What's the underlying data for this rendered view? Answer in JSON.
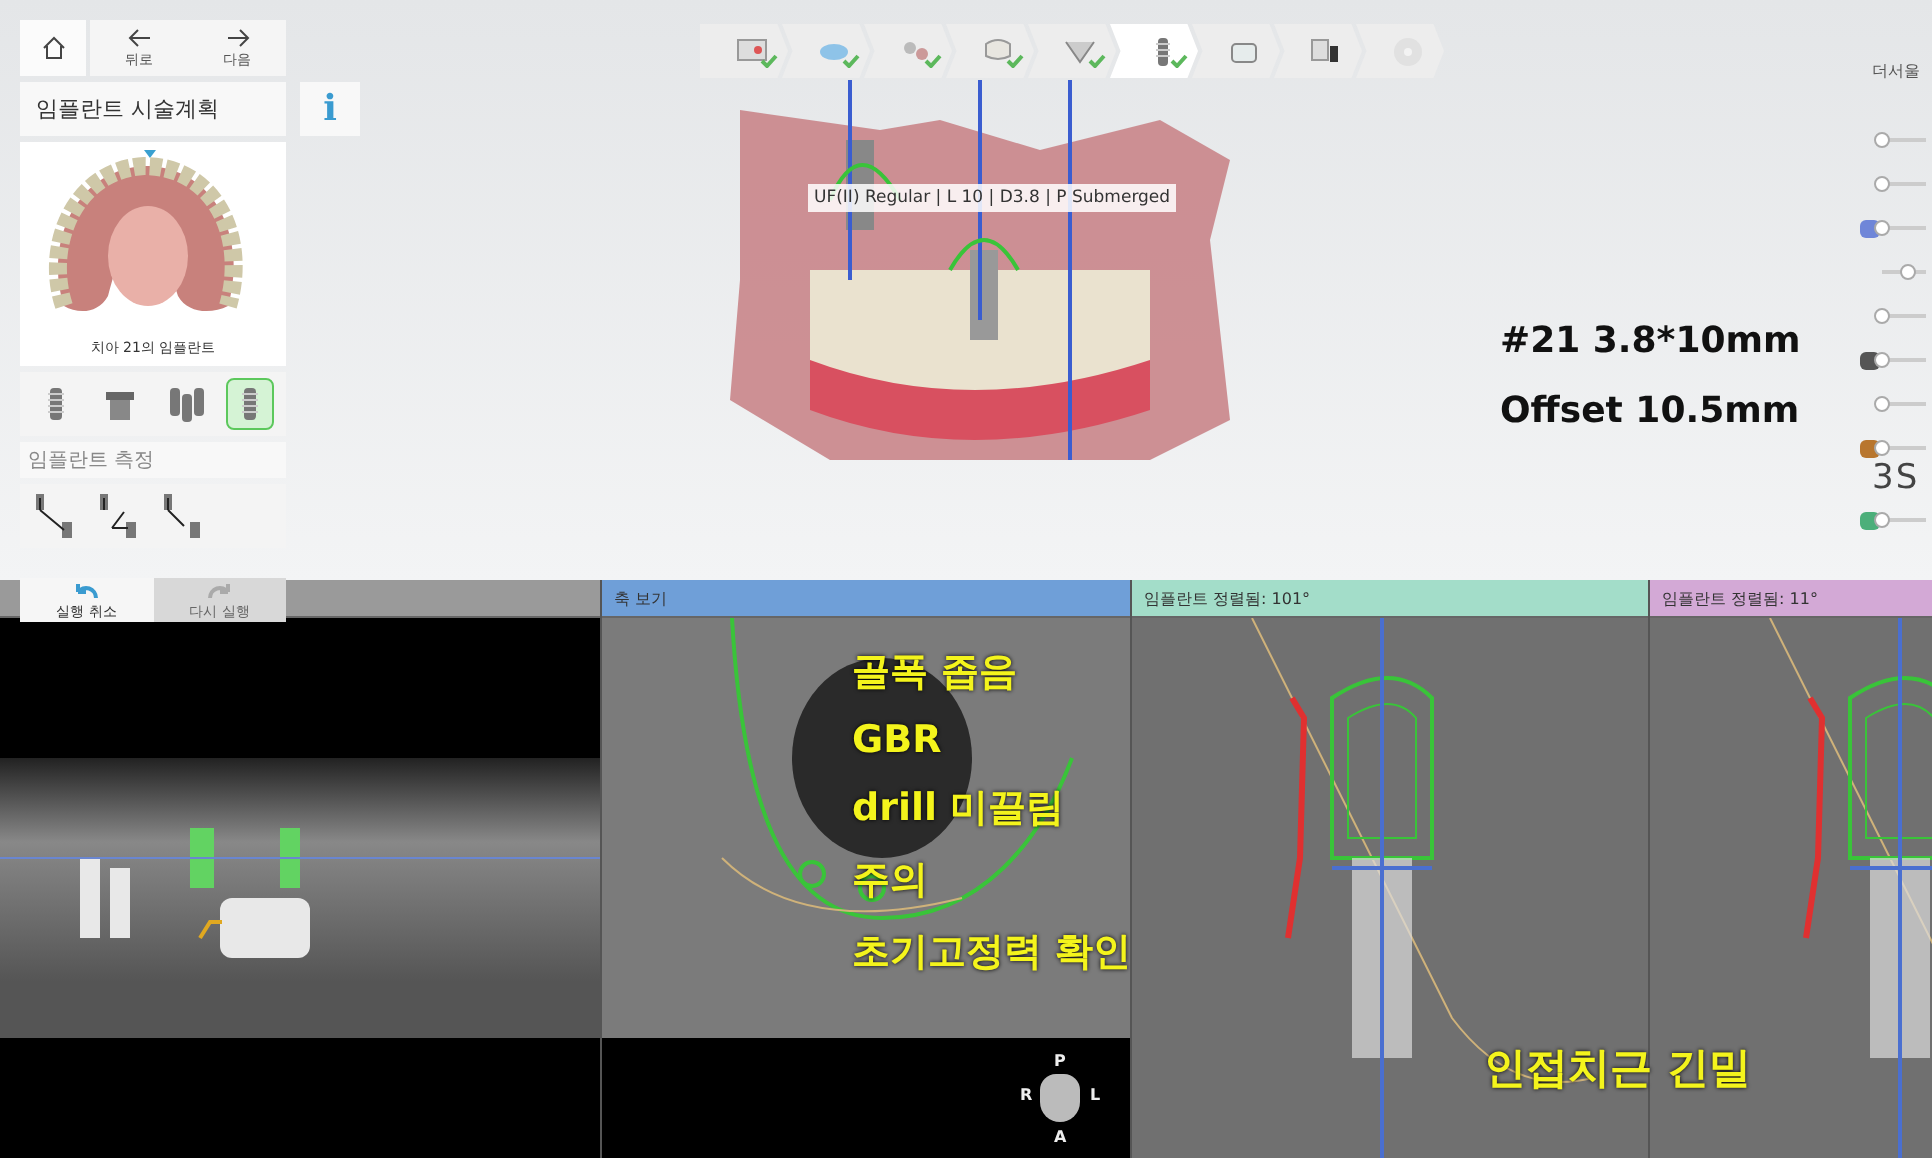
{
  "nav": {
    "back": "뒤로",
    "next": "다음"
  },
  "plan_panel": {
    "title": "임플란트 시술계획",
    "info": "i",
    "image_caption": "치아 21의 임플란트",
    "implant_tools": [
      {
        "kind": "single",
        "selected": false
      },
      {
        "kind": "abutment",
        "selected": false
      },
      {
        "kind": "multiple",
        "selected": false
      },
      {
        "kind": "single",
        "selected": true
      }
    ],
    "measure_title": "임플란트 측정",
    "undo": {
      "label": "실행 취소",
      "disabled": false
    },
    "redo": {
      "label": "다시 실행",
      "disabled": true
    }
  },
  "workflow_steps": [
    {
      "kind": "report",
      "checked": true,
      "selected": false,
      "disabled": false
    },
    {
      "kind": "scan",
      "checked": true,
      "selected": false,
      "disabled": false
    },
    {
      "kind": "align",
      "checked": true,
      "selected": false,
      "disabled": false
    },
    {
      "kind": "crown",
      "checked": true,
      "selected": false,
      "disabled": false
    },
    {
      "kind": "nerve",
      "checked": true,
      "selected": false,
      "disabled": false
    },
    {
      "kind": "implant",
      "checked": true,
      "selected": true,
      "disabled": false
    },
    {
      "kind": "guide",
      "checked": false,
      "selected": false,
      "disabled": false
    },
    {
      "kind": "export",
      "checked": false,
      "selected": false,
      "disabled": false
    },
    {
      "kind": "disc",
      "checked": false,
      "selected": false,
      "disabled": true
    }
  ],
  "tooltip": "UF(II) Regular | L 10 | D3.8 | P Submerged",
  "annotations": [
    "#21 3.8*10mm",
    "Offset 10.5mm"
  ],
  "layer_panel": {
    "title": "더서울",
    "badge": "3S",
    "sliders": [
      {
        "level": 0
      },
      {
        "level": 0
      },
      {
        "level": 0,
        "color": "#6f86d8"
      },
      {
        "level": 0.6
      },
      {
        "level": 0
      },
      {
        "level": 0,
        "color": "#555555"
      },
      {
        "level": 0
      },
      {
        "level": 0,
        "color": "#b8762e"
      },
      {
        "level": 0,
        "color": "#4caf7a"
      }
    ]
  },
  "views": [
    {
      "kind": "panoramic"
    },
    {
      "kind": "axial",
      "title": "축 보기",
      "color": "#6f9fd8",
      "notes": [
        "골폭 좁음",
        "GBR",
        "drill 미끌림",
        "주의",
        "초기고정력 확인"
      ],
      "orientation_labels": [
        "P",
        "R",
        "L",
        "A"
      ]
    },
    {
      "kind": "cross",
      "title": "임플란트 정렬됨: 101°",
      "color": "#a3ddc9"
    },
    {
      "kind": "cross",
      "title": "임플란트 정렬됨: 11°",
      "color": "#d3a9d6"
    }
  ],
  "view_note": "인접치근 긴밀"
}
